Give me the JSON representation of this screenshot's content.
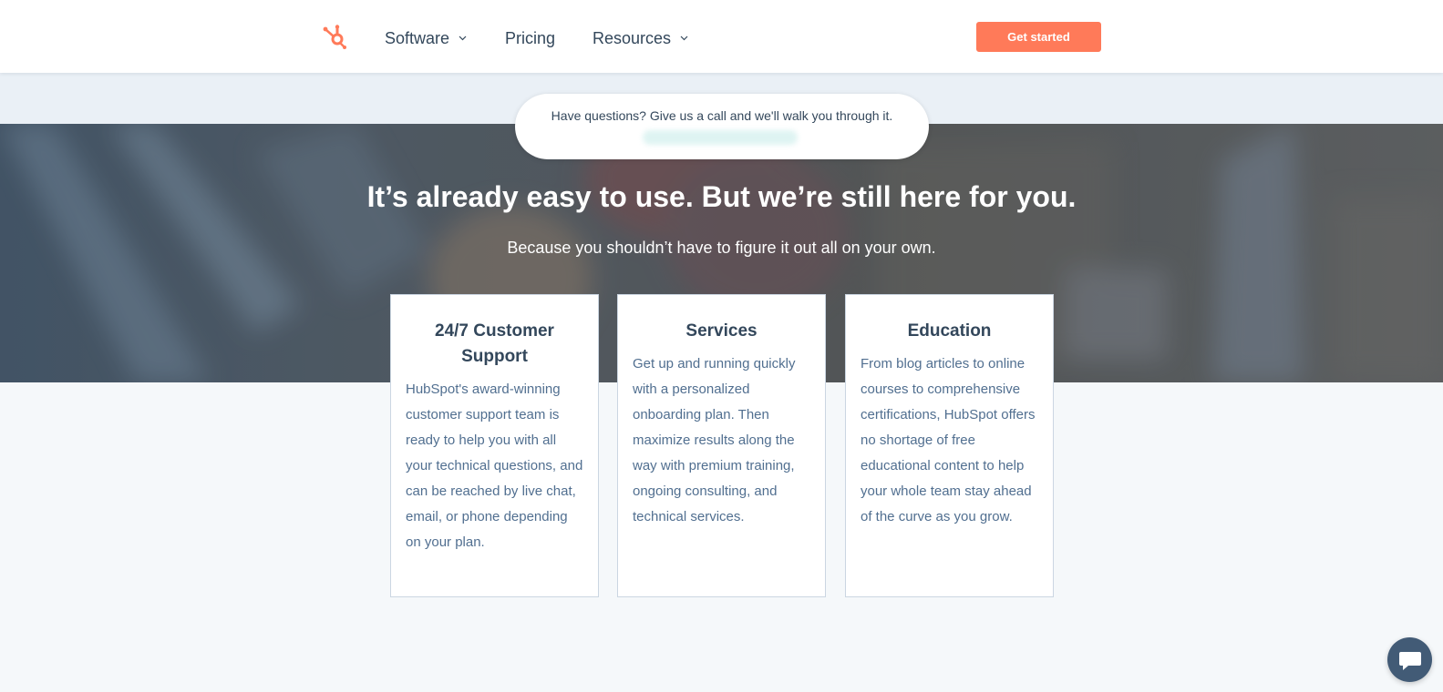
{
  "nav": {
    "items": [
      {
        "label": "Software",
        "has_dropdown": true
      },
      {
        "label": "Pricing",
        "has_dropdown": false
      },
      {
        "label": "Resources",
        "has_dropdown": true
      }
    ],
    "cta_label": "Get started",
    "logo_icon": "hubspot-sprocket-icon",
    "chevron_icon": "chevron-down-icon"
  },
  "hero": {
    "pill_text": "Have questions? Give us a call and we'll walk you through it.",
    "title": "It’s already easy to use. But we’re still here for you.",
    "subtitle": "Because you shouldn’t have to figure it out all on your own."
  },
  "cards": [
    {
      "title": "24/7 Customer Support",
      "body": "HubSpot's award-winning customer support team is ready to help you with all your technical questions, and can be reached by live chat, email, or phone depending on your plan."
    },
    {
      "title": "Services",
      "body": "Get up and running quickly with a personalized onboarding plan. Then maximize results along the way with premium training, ongoing consulting, and technical services."
    },
    {
      "title": "Education",
      "body": "From blog articles to online courses to comprehensive certifications, HubSpot offers no shortage of free educational content to help your whole team stay ahead of the curve as you grow."
    }
  ],
  "chat": {
    "icon": "chat-bubble-icon"
  },
  "colors": {
    "accent": "#ff7a59",
    "text_dark": "#33475b",
    "text_body": "#516f90",
    "page_bg": "#f5f8fa",
    "band_bg": "#eaf0f6",
    "chat_bg": "#425b76"
  }
}
